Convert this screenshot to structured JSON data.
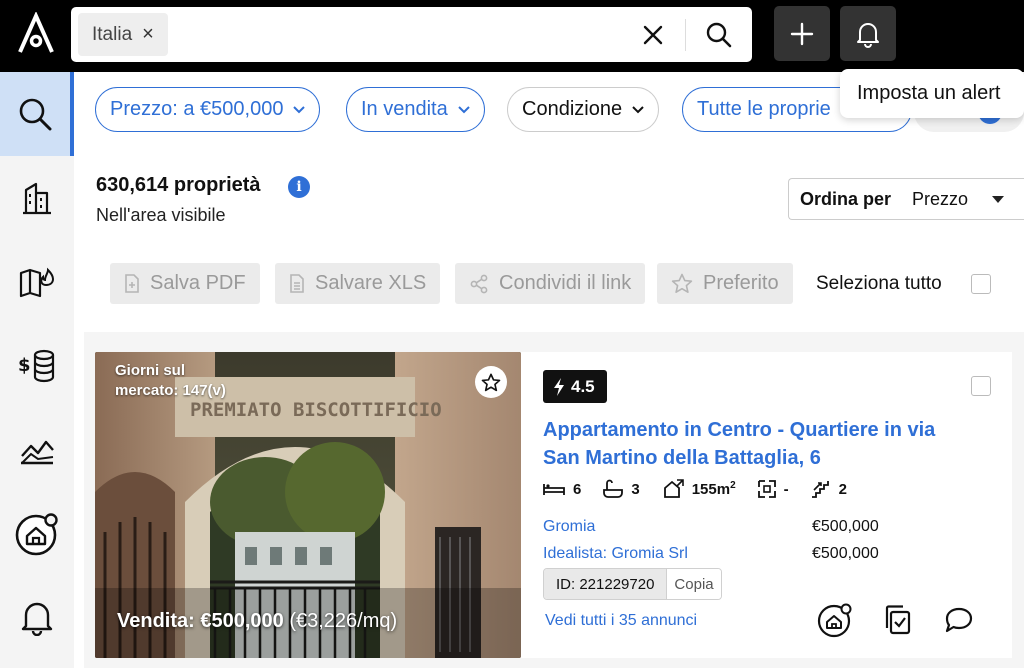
{
  "search": {
    "chip_label": "Italia",
    "chip_remove": "×"
  },
  "tooltip": {
    "text": "Imposta un alert"
  },
  "filters": [
    {
      "label": "Prezzo: a €500,000"
    },
    {
      "label": "In vendita"
    },
    {
      "label": "Condizione"
    },
    {
      "label": "Tutte le proprie"
    }
  ],
  "results": {
    "count_title": "630,614 proprietà",
    "info": "i",
    "subtitle": "Nell'area visibile"
  },
  "sort": {
    "label": "Ordina per",
    "value": "Prezzo"
  },
  "actions": {
    "save_pdf": "Salva PDF",
    "save_xls": "Salvare XLS",
    "share_link": "Condividi il link",
    "favorite": "Preferito",
    "select_all": "Seleziona tutto"
  },
  "listing": {
    "days_on_market": "Giorni sul mercato: 147(v)",
    "sign_text": "PREMIATO BISCOTTIFICIO",
    "price_label": "Vendita: €500,000",
    "price_per_sqm": "(€3,226/mq)",
    "score": "4.5",
    "title": "Appartamento in Centro - Quartiere in via San Martino della Battaglia, 6",
    "features": {
      "bedrooms": "6",
      "bathrooms": "3",
      "area": "155m",
      "area_sup": "2",
      "floor_area": "-",
      "floors": "2"
    },
    "agents": [
      {
        "name": "Gromia",
        "price": "€500,000"
      },
      {
        "name": "Idealista: Gromia Srl",
        "price": "€500,000"
      }
    ],
    "id_label": "ID: 221229720",
    "copy_label": "Copia",
    "see_all": "Vedi tutti i 35 annunci"
  },
  "colors": {
    "accent": "#2f6fd6",
    "topbar": "#000000",
    "active_nav": "#cfe0f6"
  },
  "icons": {
    "logo": "logo-icon",
    "sidebar": [
      "search-icon",
      "buildings-icon",
      "map-fire-icon",
      "money-stack-icon",
      "chart-icon",
      "home-alert-icon",
      "bell-icon"
    ]
  }
}
